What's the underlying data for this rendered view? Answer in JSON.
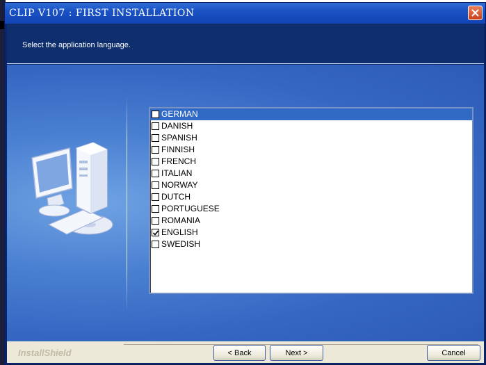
{
  "window": {
    "title": "CLIP V107 : FIRST INSTALLATION",
    "close_glyph": "✕"
  },
  "header": {
    "instruction": "Select the application language."
  },
  "languages": [
    {
      "label": "GERMAN",
      "checked": false,
      "selected": true
    },
    {
      "label": "DANISH",
      "checked": false,
      "selected": false
    },
    {
      "label": "SPANISH",
      "checked": false,
      "selected": false
    },
    {
      "label": "FINNISH",
      "checked": false,
      "selected": false
    },
    {
      "label": "FRENCH",
      "checked": false,
      "selected": false
    },
    {
      "label": "ITALIAN",
      "checked": false,
      "selected": false
    },
    {
      "label": "NORWAY",
      "checked": false,
      "selected": false
    },
    {
      "label": "DUTCH",
      "checked": false,
      "selected": false
    },
    {
      "label": "PORTUGUESE",
      "checked": false,
      "selected": false
    },
    {
      "label": "ROMANIA",
      "checked": false,
      "selected": false
    },
    {
      "label": "ENGLISH",
      "checked": true,
      "selected": false
    },
    {
      "label": "SWEDISH",
      "checked": false,
      "selected": false
    }
  ],
  "footer": {
    "brand": "InstallShield",
    "back_label": "< Back",
    "next_label": "Next >",
    "cancel_label": "Cancel"
  },
  "colors": {
    "titlebar": "#1a52c4",
    "header": "#0e2e6e",
    "selection": "#316ac5",
    "close": "#c8401c"
  },
  "icons": {
    "close": "close-icon",
    "art": "computer-install-icon"
  }
}
